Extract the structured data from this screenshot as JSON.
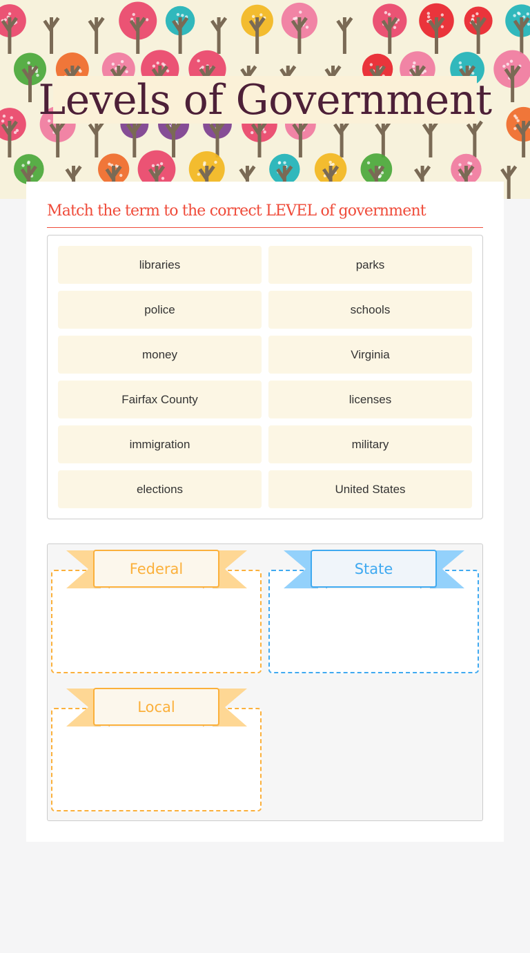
{
  "header": {
    "title": "Levels of Government",
    "background": "autumn-trees-pattern"
  },
  "instructions": "Match the term to the correct LEVEL of government",
  "word_bank": [
    "libraries",
    "parks",
    "police",
    "schools",
    "money",
    "Virginia",
    "Fairfax County",
    "licenses",
    "immigration",
    "military",
    "elections",
    "United States"
  ],
  "categories": [
    {
      "label": "Federal",
      "color": "#fbb03b",
      "items": []
    },
    {
      "label": "State",
      "color": "#3fa9f0",
      "items": []
    },
    {
      "label": "Local",
      "color": "#fbb03b",
      "items": []
    }
  ],
  "colors": {
    "title": "#4d2038",
    "instructions": "#ef4b3a",
    "tile_bg": "#fcf6e4",
    "orange": "#fbb03b",
    "orange_light": "#fed794",
    "blue": "#3fa9f0",
    "blue_light": "#93d1fb"
  }
}
